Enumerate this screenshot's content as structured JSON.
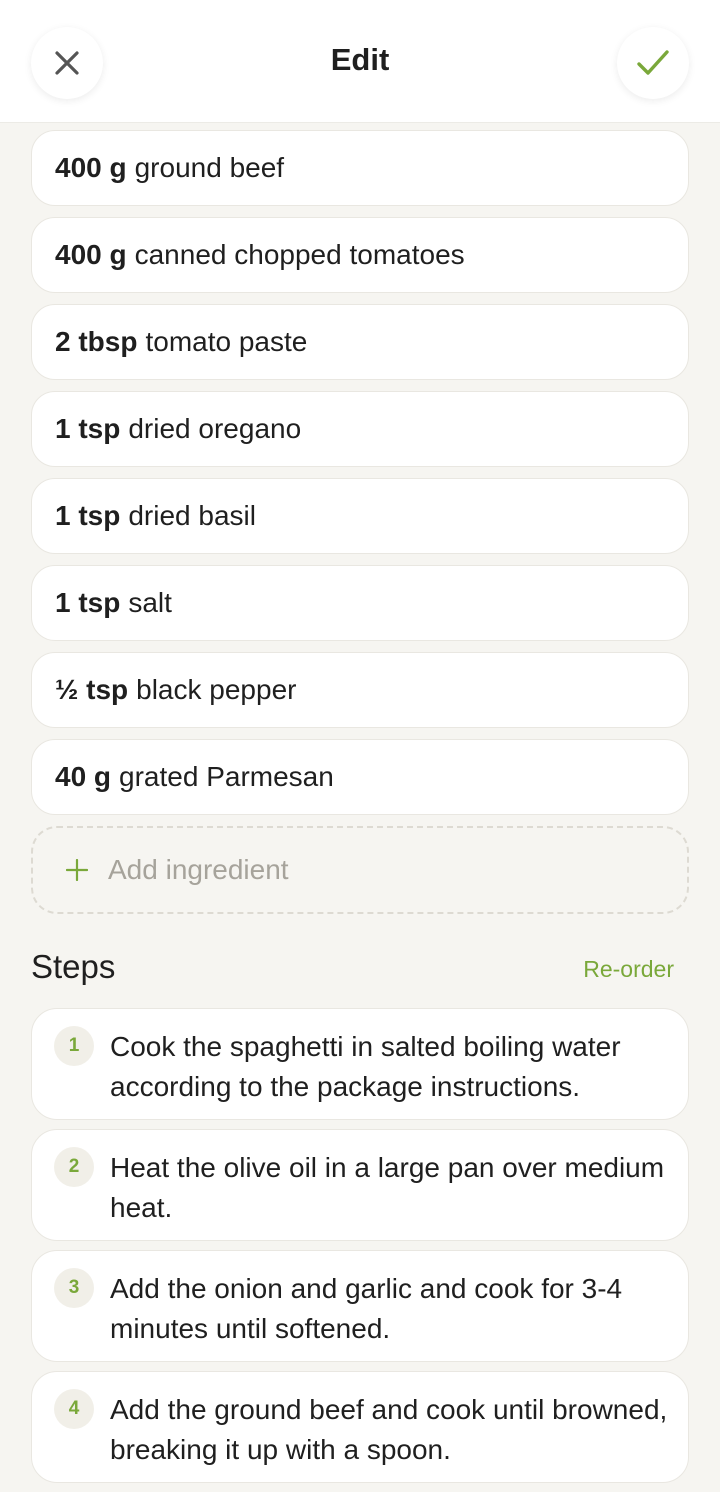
{
  "header": {
    "title": "Edit",
    "close_icon": "close-icon",
    "done_icon": "checkmark-icon",
    "accent_color": "#7aa83a"
  },
  "ingredients": [
    {
      "qty": "400 g",
      "name": "ground beef"
    },
    {
      "qty": "400 g",
      "name": "canned chopped tomatoes"
    },
    {
      "qty": "2 tbsp",
      "name": "tomato paste"
    },
    {
      "qty": "1 tsp",
      "name": "dried oregano"
    },
    {
      "qty": "1 tsp",
      "name": "dried basil"
    },
    {
      "qty": "1 tsp",
      "name": "salt"
    },
    {
      "qty": "½ tsp",
      "name": "black pepper"
    },
    {
      "qty": "40 g",
      "name": "grated Parmesan"
    }
  ],
  "add_ingredient": {
    "label": "Add ingredient",
    "icon": "plus-icon"
  },
  "steps_section": {
    "title": "Steps",
    "reorder_label": "Re-order"
  },
  "steps": [
    {
      "num": "1",
      "text": "Cook the spaghetti in salted boiling water according to the package instructions."
    },
    {
      "num": "2",
      "text": "Heat the olive oil in a large pan over medium heat."
    },
    {
      "num": "3",
      "text": "Add the onion and garlic and cook for 3-4 minutes until softened."
    },
    {
      "num": "4",
      "text": "Add the ground beef and cook until browned, breaking it up with a spoon."
    }
  ]
}
